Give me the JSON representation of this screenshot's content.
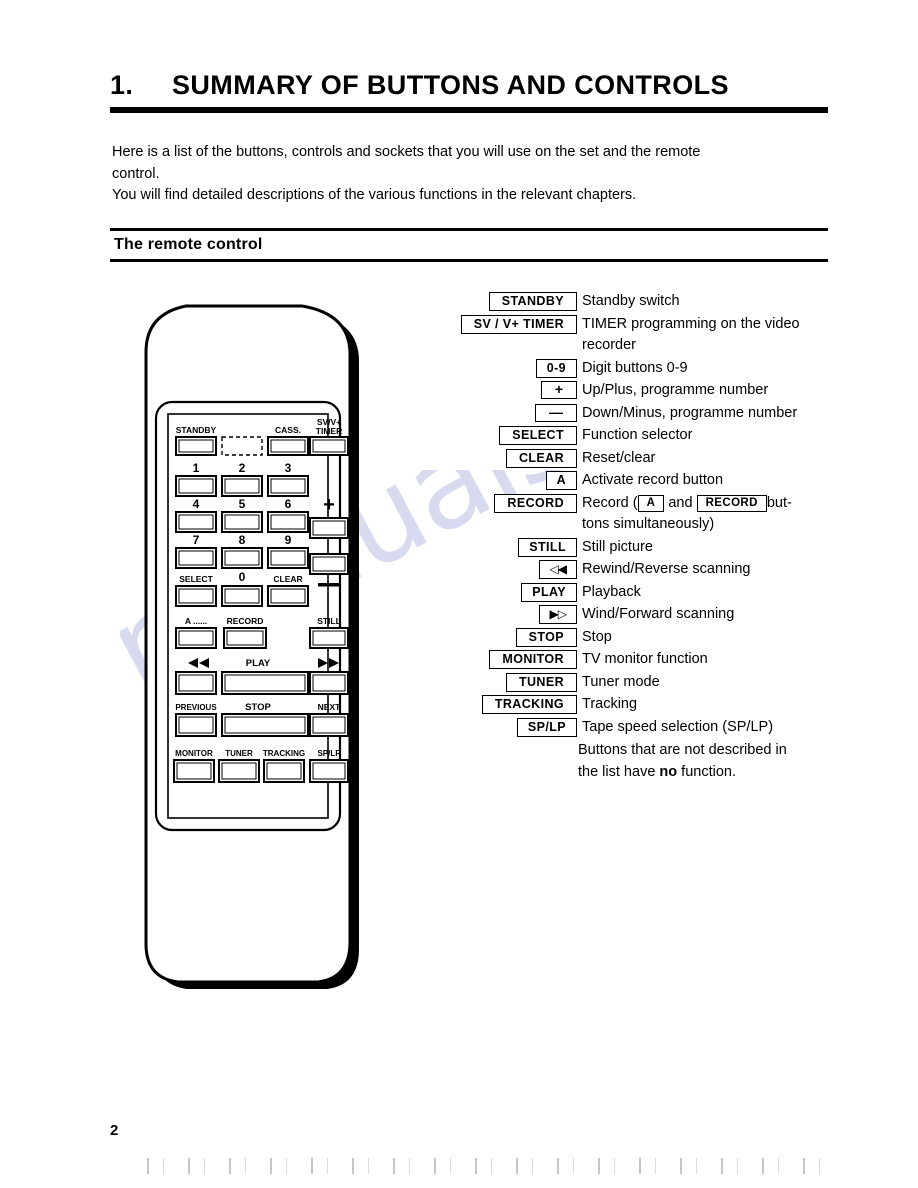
{
  "chapter": {
    "number": "1.",
    "title": "SUMMARY OF BUTTONS AND CONTROLS"
  },
  "intro": {
    "line1": "Here is a list of the buttons, controls and sockets that you will use on the set and the remote",
    "line2": "control.",
    "line3": "You will find detailed descriptions of the various functions in the relevant chapters."
  },
  "subhead": {
    "label": "The remote control"
  },
  "legend": {
    "rows": [
      {
        "key": "STANDBY",
        "style": "wide",
        "desc": "Standby switch",
        "cont": ""
      },
      {
        "key": "SV / V+  TIMER",
        "style": "wide",
        "desc": "TIMER programming on the video",
        "cont": "recorder"
      },
      {
        "key": "0-9",
        "style": "tiny",
        "desc": "Digit buttons 0-9",
        "cont": ""
      },
      {
        "key": "+",
        "style": "sym",
        "desc": "Up/Plus, programme number",
        "cont": ""
      },
      {
        "key": "—",
        "style": "sym",
        "desc": "Down/Minus, programme number",
        "cont": ""
      },
      {
        "key": "SELECT",
        "style": "wide",
        "desc": "Function selector",
        "cont": ""
      },
      {
        "key": "CLEAR",
        "style": "wide",
        "desc": "Reset/clear",
        "cont": ""
      },
      {
        "key": "A",
        "style": "tiny",
        "desc": "Activate record button",
        "cont": ""
      },
      {
        "key": "RECORD",
        "style": "wide",
        "desc": "__RECORD_INLINE__",
        "cont": "tons simultaneously)"
      },
      {
        "key": "STILL",
        "style": "tiny",
        "desc": "Still picture",
        "cont": ""
      },
      {
        "key": "◁◀",
        "style": "tiny",
        "desc": "Rewind/Reverse scanning",
        "cont": ""
      },
      {
        "key": "PLAY",
        "style": "tiny",
        "desc": "Playback",
        "cont": ""
      },
      {
        "key": "▶▷",
        "style": "tiny",
        "desc": "Wind/Forward scanning",
        "cont": ""
      },
      {
        "key": "STOP",
        "style": "wide",
        "desc": "Stop",
        "cont": ""
      },
      {
        "key": "MONITOR",
        "style": "wide",
        "desc": "TV monitor function",
        "cont": ""
      },
      {
        "key": "TUNER",
        "style": "wide",
        "desc": "Tuner mode",
        "cont": ""
      },
      {
        "key": "TRACKING",
        "style": "wide",
        "desc": "Tracking",
        "cont": ""
      },
      {
        "key": "SP/LP",
        "style": "tiny",
        "desc": "Tape speed selection (SP/LP)",
        "cont": ""
      }
    ],
    "record_line": {
      "prefix": "Record (",
      "box_a": "A",
      "mid": "and",
      "box_record": "RECORD",
      "suffix": "but-"
    }
  },
  "note": {
    "line1": "Buttons that are not described in",
    "line2_before": "the list have ",
    "line2_bold": "no",
    "line2_after": " function."
  },
  "remote": {
    "rows": [
      {
        "labels": [
          "STANDBY",
          "",
          "CASS.",
          "SV/V+\nTIMER"
        ]
      },
      {
        "labels": [
          "1",
          "2",
          "3",
          ""
        ]
      },
      {
        "labels": [
          "4",
          "5",
          "6",
          "+"
        ]
      },
      {
        "labels": [
          "7",
          "8",
          "9",
          ""
        ]
      },
      {
        "labels": [
          "SELECT",
          "0",
          "CLEAR",
          "—"
        ]
      },
      {
        "labels": [
          "A ......",
          "RECORD",
          "",
          "STILL"
        ]
      },
      {
        "labels": [
          "◀◀",
          "PLAY",
          "",
          "▶▶"
        ]
      },
      {
        "labels": [
          "PREVIOUS",
          "STOP",
          "",
          "NEXT"
        ]
      },
      {
        "labels": [
          "MONITOR",
          "TUNER",
          "TRACKING",
          "SP/LP"
        ]
      }
    ],
    "key_labels": {
      "standby": "STANDBY",
      "cass": "CASS.",
      "svv_line1": "SV/V+",
      "svv_line2": "TIMER",
      "d1": "1",
      "d2": "2",
      "d3": "3",
      "d4": "4",
      "d5": "5",
      "d6": "6",
      "d7": "7",
      "d8": "8",
      "d9": "9",
      "d0": "0",
      "select": "SELECT",
      "clear": "CLEAR",
      "plus": "+",
      "minus": "—",
      "a_dots": "A ......",
      "record": "RECORD",
      "still": "STILL",
      "rew": "◀◀",
      "play": "PLAY",
      "ff": "▶▶",
      "previous": "PREVIOUS",
      "stop": "STOP",
      "next": "NEXT",
      "monitor": "MONITOR",
      "tuner": "TUNER",
      "tracking": "TRACKING",
      "splp": "SP/LP"
    }
  },
  "page": {
    "number": "2"
  },
  "watermark": {
    "text": "manualshive.com"
  },
  "colors": {
    "ink": "#000000",
    "paper": "#ffffff",
    "watermark": "#b9bde4"
  }
}
